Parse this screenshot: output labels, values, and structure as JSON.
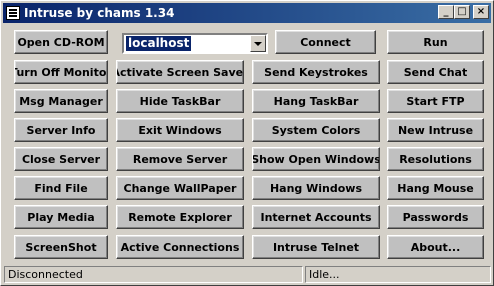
{
  "window": {
    "title": "Intruse by chams 1.34"
  },
  "host_combo": {
    "value": "localhost"
  },
  "buttons": {
    "open_cdrom": "Open CD-ROM",
    "connect": "Connect",
    "run": "Run",
    "turn_off_monitor": "Turn Off Monitor",
    "activate_screen_saver": "Activate Screen Saver",
    "send_keystrokes": "Send Keystrokes",
    "send_chat": "Send Chat",
    "msg_manager": "Msg Manager",
    "hide_taskbar": "Hide TaskBar",
    "hang_taskbar": "Hang TaskBar",
    "start_ftp": "Start FTP",
    "server_info": "Server Info",
    "exit_windows": "Exit Windows",
    "system_colors": "System Colors",
    "new_intruse": "New Intruse",
    "close_server": "Close Server",
    "remove_server": "Remove Server",
    "show_open_windows": "Show Open Windows",
    "resolutions": "Resolutions",
    "find_file": "Find File",
    "change_wallpaper": "Change WallPaper",
    "hang_windows": "Hang Windows",
    "hang_mouse": "Hang Mouse",
    "play_media": "Play Media",
    "remote_explorer": "Remote Explorer",
    "internet_accounts": "Internet Accounts",
    "passwords": "Passwords",
    "screenshot": "ScreenShot",
    "active_connections": "Active Connections",
    "intruse_telnet": "Intruse Telnet",
    "about": "About..."
  },
  "status_bar": {
    "left": "Disconnected",
    "right": "Idle..."
  }
}
